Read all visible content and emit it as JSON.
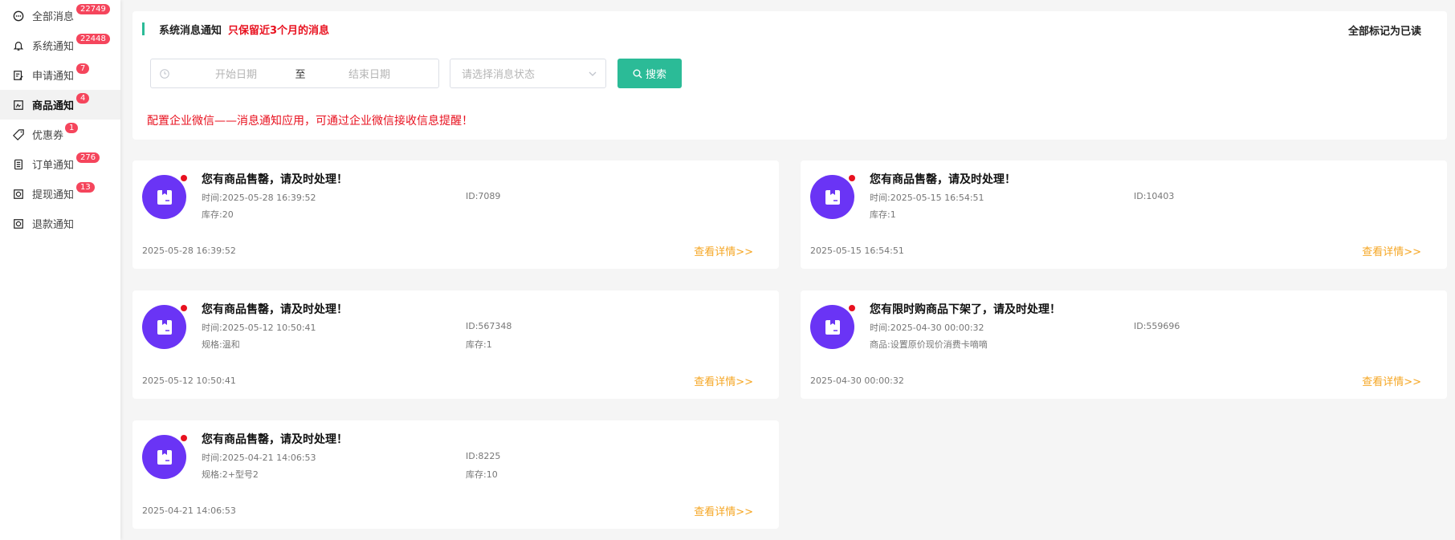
{
  "sidebar": {
    "items": [
      {
        "label": "全部消息",
        "badge": "22749",
        "icon": "chat-icon"
      },
      {
        "label": "系统通知",
        "badge": "22448",
        "icon": "bell-icon"
      },
      {
        "label": "申请通知",
        "badge": "7",
        "icon": "form-icon"
      },
      {
        "label": "商品通知",
        "badge": "4",
        "icon": "product-icon"
      },
      {
        "label": "优惠券",
        "badge": "1",
        "icon": "coupon-icon"
      },
      {
        "label": "订单通知",
        "badge": "276",
        "icon": "order-icon"
      },
      {
        "label": "提现通知",
        "badge": "13",
        "icon": "withdraw-icon"
      },
      {
        "label": "退款通知",
        "badge": "",
        "icon": "refund-icon"
      }
    ],
    "active_index": 3
  },
  "header": {
    "title": "系统消息通知",
    "warning": "只保留近3个月的消息",
    "mark_all_read": "全部标记为已读"
  },
  "filters": {
    "start_placeholder": "开始日期",
    "separator": "至",
    "end_placeholder": "结束日期",
    "status_placeholder": "请选择消息状态",
    "search_label": "搜索"
  },
  "tip": "配置企业微信——消息通知应用，可通过企业微信接收信息提醒！",
  "cards": [
    {
      "title": "您有商品售罄，请及时处理！",
      "time": "时间:2025-05-28 16:39:52",
      "id": "ID:7089",
      "extra1": "库存:20",
      "extra2": "",
      "date": "2025-05-28 16:39:52",
      "link": "查看详情>>"
    },
    {
      "title": "您有商品售罄，请及时处理！",
      "time": "时间:2025-05-15 16:54:51",
      "id": "ID:10403",
      "extra1": "库存:1",
      "extra2": "",
      "date": "2025-05-15 16:54:51",
      "link": "查看详情>>"
    },
    {
      "title": "您有商品售罄，请及时处理！",
      "time": "时间:2025-05-12 10:50:41",
      "id": "ID:567348",
      "extra1": "规格:温和",
      "extra2": "库存:1",
      "date": "2025-05-12 10:50:41",
      "link": "查看详情>>"
    },
    {
      "title": "您有限时购商品下架了，请及时处理！",
      "time": "时间:2025-04-30 00:00:32",
      "id": "ID:559696",
      "extra1": "商品:设置原价现价消费卡嘀嘀",
      "extra2": "",
      "date": "2025-04-30 00:00:32",
      "link": "查看详情>>"
    },
    {
      "title": "您有商品售罄，请及时处理！",
      "time": "时间:2025-04-21 14:06:53",
      "id": "ID:8225",
      "extra1": "规格:2+型号2",
      "extra2": "库存:10",
      "date": "2025-04-21 14:06:53",
      "link": "查看详情>>"
    }
  ],
  "colors": {
    "accent": "#2bbb97",
    "warning": "#e8111f",
    "badge": "#f5455c",
    "avatar": "#6a34f5",
    "link": "#f5a623"
  }
}
